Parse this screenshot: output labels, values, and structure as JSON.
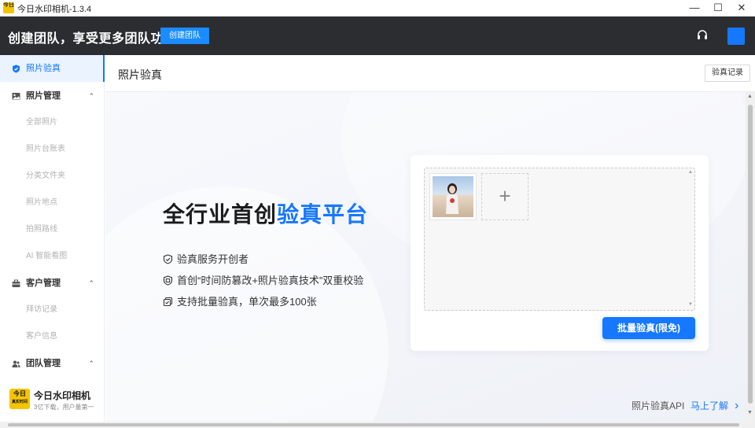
{
  "window": {
    "title": "今日水印相机-1.3.4",
    "icon_text": "今日",
    "controls": {
      "minimize": "—",
      "maximize": "☐",
      "close": "✕"
    }
  },
  "header": {
    "promo_text": "创建团队，享受更多团队功能",
    "create_team_button": "创建团队",
    "support_icon": "headset-icon",
    "colors": {
      "bar": "#2b2d31",
      "accent": "#1a8cff"
    }
  },
  "sidebar": {
    "items": [
      {
        "label": "照片验真",
        "icon": "shield-icon",
        "active": true
      },
      {
        "label": "照片管理",
        "icon": "image-icon",
        "expanded": true,
        "chevron": "⌃"
      },
      {
        "label": "全部照片"
      },
      {
        "label": "照片台账表"
      },
      {
        "label": "分类文件夹"
      },
      {
        "label": "照片地点"
      },
      {
        "label": "拍照路线"
      },
      {
        "label": "AI 智能看图"
      },
      {
        "label": "客户管理",
        "icon": "briefcase-icon",
        "expanded": true,
        "chevron": "⌃"
      },
      {
        "label": "拜访记录"
      },
      {
        "label": "客户信息"
      },
      {
        "label": "团队管理",
        "icon": "team-icon",
        "expanded": true,
        "chevron": "⌃"
      }
    ],
    "brand": {
      "logo_text": "今日",
      "logo_sub": "真实时间",
      "name": "今日水印相机",
      "tagline": "3亿下载，用户量第一"
    }
  },
  "page": {
    "title": "照片验真",
    "records_button": "验真记录"
  },
  "hero": {
    "title_main": "全行业首创",
    "title_highlight": "验真平台",
    "features": [
      {
        "icon": "shield-check-icon",
        "text": "验真服务开创者"
      },
      {
        "icon": "shield-badge-icon",
        "text": "首创“时间防篡改+照片验真技术”双重校验"
      },
      {
        "icon": "copy-check-icon",
        "text": "支持批量验真，单次最多100张"
      }
    ]
  },
  "upload": {
    "add_symbol": "+",
    "verify_button": "批量验真(限免)"
  },
  "footer": {
    "api_label": "照片验真API",
    "api_link": "马上了解",
    "api_chevron": "›"
  },
  "colors": {
    "accent": "#1677ff",
    "brand_yellow": "#f5c400"
  }
}
